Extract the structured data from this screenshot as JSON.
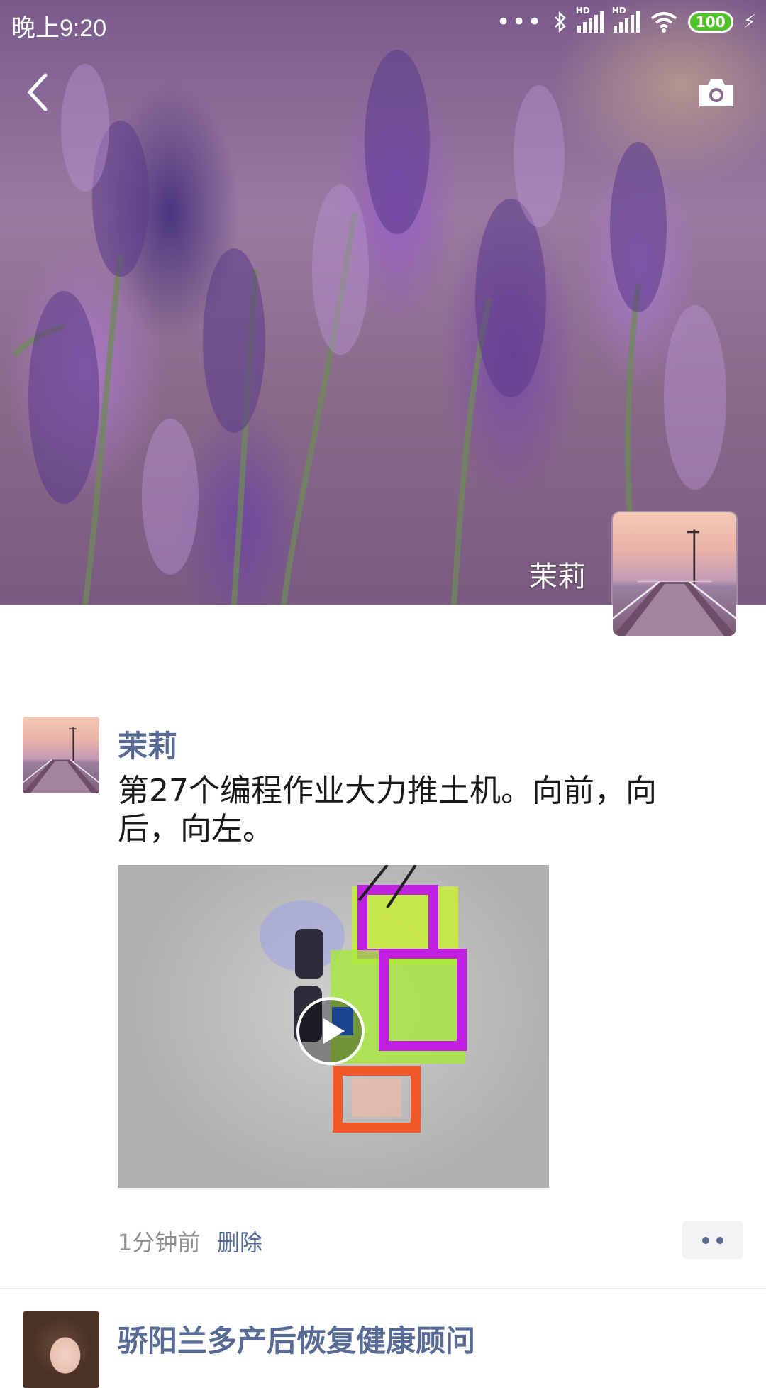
{
  "status_bar": {
    "time": "晚上9:20",
    "battery": "100",
    "icons": [
      "more-dots-icon",
      "bluetooth-icon",
      "hd-signal-icon",
      "hd-signal-icon",
      "wifi-icon",
      "battery-icon",
      "charging-icon"
    ]
  },
  "header": {
    "back_icon": "back-chevron-icon",
    "camera_icon": "camera-icon",
    "user_name": "茉莉"
  },
  "posts": [
    {
      "author": "茉莉",
      "text": "第27个编程作业大力推土机。向前，向后，向左。",
      "media": "video",
      "time": "1分钟前",
      "delete_label": "删除",
      "more_icon": "comment-dots-icon"
    },
    {
      "author": "骄阳兰多产后恢复健康顾问"
    }
  ],
  "colors": {
    "link": "#576b95",
    "meta": "#8f8f8f",
    "battery": "#52c22a"
  }
}
